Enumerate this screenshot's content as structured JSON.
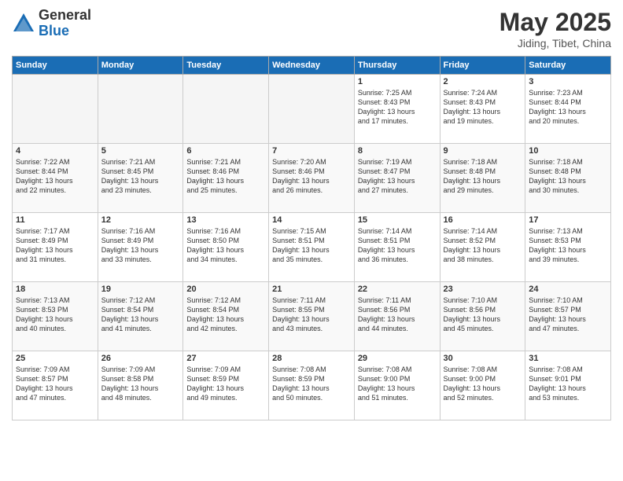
{
  "logo": {
    "general": "General",
    "blue": "Blue"
  },
  "header": {
    "month": "May 2025",
    "location": "Jiding, Tibet, China"
  },
  "weekdays": [
    "Sunday",
    "Monday",
    "Tuesday",
    "Wednesday",
    "Thursday",
    "Friday",
    "Saturday"
  ],
  "weeks": [
    [
      {
        "day": "",
        "info": ""
      },
      {
        "day": "",
        "info": ""
      },
      {
        "day": "",
        "info": ""
      },
      {
        "day": "",
        "info": ""
      },
      {
        "day": "1",
        "info": "Sunrise: 7:25 AM\nSunset: 8:43 PM\nDaylight: 13 hours\nand 17 minutes."
      },
      {
        "day": "2",
        "info": "Sunrise: 7:24 AM\nSunset: 8:43 PM\nDaylight: 13 hours\nand 19 minutes."
      },
      {
        "day": "3",
        "info": "Sunrise: 7:23 AM\nSunset: 8:44 PM\nDaylight: 13 hours\nand 20 minutes."
      }
    ],
    [
      {
        "day": "4",
        "info": "Sunrise: 7:22 AM\nSunset: 8:44 PM\nDaylight: 13 hours\nand 22 minutes."
      },
      {
        "day": "5",
        "info": "Sunrise: 7:21 AM\nSunset: 8:45 PM\nDaylight: 13 hours\nand 23 minutes."
      },
      {
        "day": "6",
        "info": "Sunrise: 7:21 AM\nSunset: 8:46 PM\nDaylight: 13 hours\nand 25 minutes."
      },
      {
        "day": "7",
        "info": "Sunrise: 7:20 AM\nSunset: 8:46 PM\nDaylight: 13 hours\nand 26 minutes."
      },
      {
        "day": "8",
        "info": "Sunrise: 7:19 AM\nSunset: 8:47 PM\nDaylight: 13 hours\nand 27 minutes."
      },
      {
        "day": "9",
        "info": "Sunrise: 7:18 AM\nSunset: 8:48 PM\nDaylight: 13 hours\nand 29 minutes."
      },
      {
        "day": "10",
        "info": "Sunrise: 7:18 AM\nSunset: 8:48 PM\nDaylight: 13 hours\nand 30 minutes."
      }
    ],
    [
      {
        "day": "11",
        "info": "Sunrise: 7:17 AM\nSunset: 8:49 PM\nDaylight: 13 hours\nand 31 minutes."
      },
      {
        "day": "12",
        "info": "Sunrise: 7:16 AM\nSunset: 8:49 PM\nDaylight: 13 hours\nand 33 minutes."
      },
      {
        "day": "13",
        "info": "Sunrise: 7:16 AM\nSunset: 8:50 PM\nDaylight: 13 hours\nand 34 minutes."
      },
      {
        "day": "14",
        "info": "Sunrise: 7:15 AM\nSunset: 8:51 PM\nDaylight: 13 hours\nand 35 minutes."
      },
      {
        "day": "15",
        "info": "Sunrise: 7:14 AM\nSunset: 8:51 PM\nDaylight: 13 hours\nand 36 minutes."
      },
      {
        "day": "16",
        "info": "Sunrise: 7:14 AM\nSunset: 8:52 PM\nDaylight: 13 hours\nand 38 minutes."
      },
      {
        "day": "17",
        "info": "Sunrise: 7:13 AM\nSunset: 8:53 PM\nDaylight: 13 hours\nand 39 minutes."
      }
    ],
    [
      {
        "day": "18",
        "info": "Sunrise: 7:13 AM\nSunset: 8:53 PM\nDaylight: 13 hours\nand 40 minutes."
      },
      {
        "day": "19",
        "info": "Sunrise: 7:12 AM\nSunset: 8:54 PM\nDaylight: 13 hours\nand 41 minutes."
      },
      {
        "day": "20",
        "info": "Sunrise: 7:12 AM\nSunset: 8:54 PM\nDaylight: 13 hours\nand 42 minutes."
      },
      {
        "day": "21",
        "info": "Sunrise: 7:11 AM\nSunset: 8:55 PM\nDaylight: 13 hours\nand 43 minutes."
      },
      {
        "day": "22",
        "info": "Sunrise: 7:11 AM\nSunset: 8:56 PM\nDaylight: 13 hours\nand 44 minutes."
      },
      {
        "day": "23",
        "info": "Sunrise: 7:10 AM\nSunset: 8:56 PM\nDaylight: 13 hours\nand 45 minutes."
      },
      {
        "day": "24",
        "info": "Sunrise: 7:10 AM\nSunset: 8:57 PM\nDaylight: 13 hours\nand 47 minutes."
      }
    ],
    [
      {
        "day": "25",
        "info": "Sunrise: 7:09 AM\nSunset: 8:57 PM\nDaylight: 13 hours\nand 47 minutes."
      },
      {
        "day": "26",
        "info": "Sunrise: 7:09 AM\nSunset: 8:58 PM\nDaylight: 13 hours\nand 48 minutes."
      },
      {
        "day": "27",
        "info": "Sunrise: 7:09 AM\nSunset: 8:59 PM\nDaylight: 13 hours\nand 49 minutes."
      },
      {
        "day": "28",
        "info": "Sunrise: 7:08 AM\nSunset: 8:59 PM\nDaylight: 13 hours\nand 50 minutes."
      },
      {
        "day": "29",
        "info": "Sunrise: 7:08 AM\nSunset: 9:00 PM\nDaylight: 13 hours\nand 51 minutes."
      },
      {
        "day": "30",
        "info": "Sunrise: 7:08 AM\nSunset: 9:00 PM\nDaylight: 13 hours\nand 52 minutes."
      },
      {
        "day": "31",
        "info": "Sunrise: 7:08 AM\nSunset: 9:01 PM\nDaylight: 13 hours\nand 53 minutes."
      }
    ]
  ]
}
